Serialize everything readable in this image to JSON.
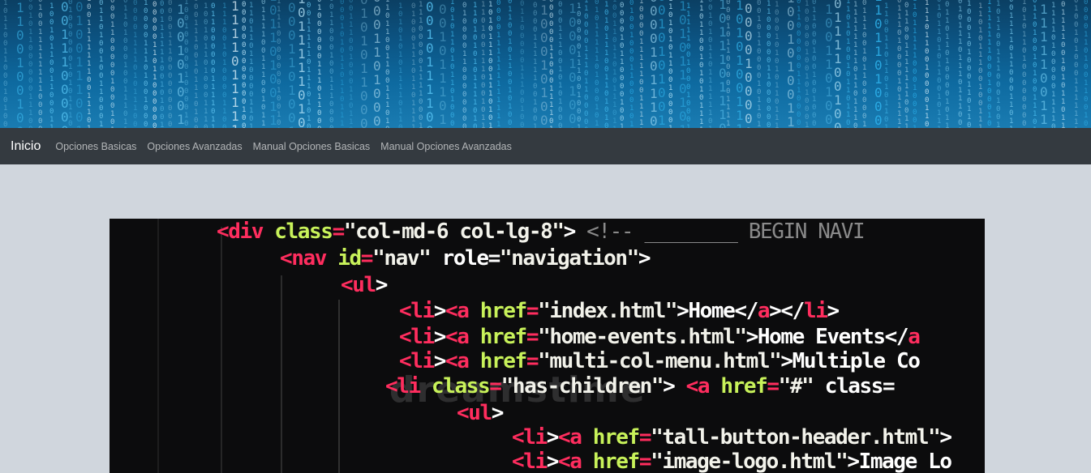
{
  "nav": {
    "brand": "Inicio",
    "links": [
      "Opciones Basicas",
      "Opciones Avanzadas",
      "Manual Opciones Basicas",
      "Manual Opciones Avanzadas"
    ]
  },
  "banner": {
    "icon": "binary-code-banner-image"
  },
  "code_image": {
    "watermark": "dreamstime",
    "lines": [
      [
        [
          "tag",
          "<div "
        ],
        [
          "attr",
          "class"
        ],
        [
          "tag",
          "="
        ],
        [
          "str",
          "\"col-md-6 col-lg-8\""
        ],
        [
          "txt",
          "> "
        ],
        [
          "cmt",
          "<!-- ________ BEGIN NAVI"
        ]
      ],
      [
        [
          "tag",
          "<nav "
        ],
        [
          "attr",
          "id"
        ],
        [
          "tag",
          "="
        ],
        [
          "str",
          "\"nav\""
        ],
        [
          "txt",
          " role="
        ],
        [
          "str",
          "\"navigation\""
        ],
        [
          "txt",
          ">"
        ]
      ],
      [
        [
          "tag",
          "<ul"
        ],
        [
          "txt",
          ">"
        ]
      ],
      [
        [
          "tag",
          "<li"
        ],
        [
          "txt",
          ">"
        ],
        [
          "tag",
          "<a "
        ],
        [
          "attr",
          "href"
        ],
        [
          "tag",
          "="
        ],
        [
          "str",
          "\"index.html\""
        ],
        [
          "txt",
          ">Home</"
        ],
        [
          "tag",
          "a"
        ],
        [
          "txt",
          "></"
        ],
        [
          "tag",
          "li"
        ],
        [
          "txt",
          ">"
        ]
      ],
      [
        [
          "tag",
          "<li"
        ],
        [
          "txt",
          ">"
        ],
        [
          "tag",
          "<a "
        ],
        [
          "attr",
          "href"
        ],
        [
          "tag",
          "="
        ],
        [
          "str",
          "\"home-events.html\""
        ],
        [
          "txt",
          ">Home Events</"
        ],
        [
          "tag",
          "a"
        ]
      ],
      [
        [
          "tag",
          "<li"
        ],
        [
          "txt",
          ">"
        ],
        [
          "tag",
          "<a "
        ],
        [
          "attr",
          "href"
        ],
        [
          "tag",
          "="
        ],
        [
          "str",
          "\"multi-col-menu.html\""
        ],
        [
          "txt",
          ">Multiple Co"
        ]
      ],
      [
        [
          "tag",
          "<li "
        ],
        [
          "attr",
          "class"
        ],
        [
          "tag",
          "="
        ],
        [
          "str",
          "\"has-children\""
        ],
        [
          "txt",
          "> "
        ],
        [
          "tag",
          "<a "
        ],
        [
          "attr",
          "href"
        ],
        [
          "tag",
          "="
        ],
        [
          "str",
          "\"#\""
        ],
        [
          "txt",
          " class="
        ]
      ],
      [
        [
          "tag",
          "<ul"
        ],
        [
          "txt",
          ">"
        ]
      ],
      [
        [
          "tag",
          "<li"
        ],
        [
          "txt",
          ">"
        ],
        [
          "tag",
          "<a "
        ],
        [
          "attr",
          "href"
        ],
        [
          "tag",
          "="
        ],
        [
          "str",
          "\"tall-button-header.html\""
        ],
        [
          "txt",
          ">"
        ]
      ],
      [
        [
          "tag",
          "<li"
        ],
        [
          "txt",
          ">"
        ],
        [
          "tag",
          "<a "
        ],
        [
          "attr",
          "href"
        ],
        [
          "tag",
          "="
        ],
        [
          "str",
          "\"image-logo.html\""
        ],
        [
          "txt",
          ">Image Lo"
        ]
      ]
    ]
  }
}
